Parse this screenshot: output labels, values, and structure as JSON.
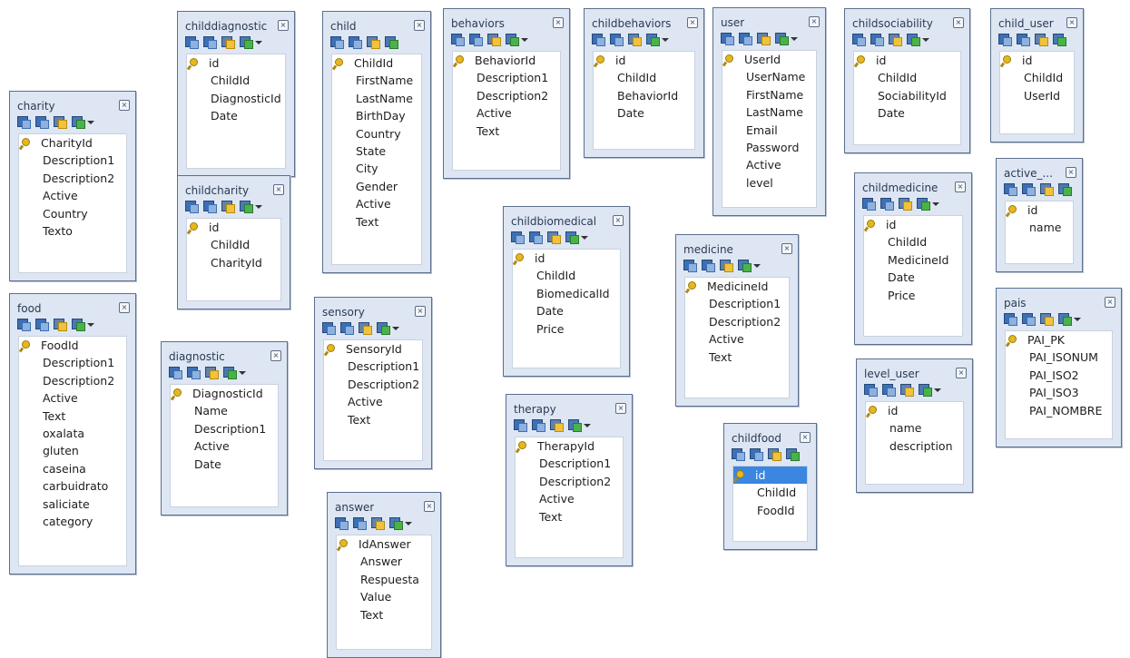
{
  "tables": [
    {
      "name": "charity",
      "fields": [
        "CharityId",
        "Description1",
        "Description2",
        "Active",
        "Country",
        "Texto"
      ],
      "key": "CharityId"
    },
    {
      "name": "food",
      "fields": [
        "FoodId",
        "Description1",
        "Description2",
        "Active",
        "Text",
        "oxalata",
        "gluten",
        "caseina",
        "carbuidrato",
        "saliciate",
        "category"
      ],
      "key": "FoodId"
    },
    {
      "name": "childdiagnostic",
      "fields": [
        "id",
        "ChildId",
        "DiagnosticId",
        "Date"
      ],
      "key": "id"
    },
    {
      "name": "childcharity",
      "fields": [
        "id",
        "ChildId",
        "CharityId"
      ],
      "key": "id"
    },
    {
      "name": "diagnostic",
      "fields": [
        "DiagnosticId",
        "Name",
        "Description1",
        "Active",
        "Date"
      ],
      "key": "DiagnosticId"
    },
    {
      "name": "child",
      "fields": [
        "ChildId",
        "FirstName",
        "LastName",
        "BirthDay",
        "Country",
        "State",
        "City",
        "Gender",
        "Active",
        "Text"
      ],
      "key": "ChildId"
    },
    {
      "name": "sensory",
      "fields": [
        "SensoryId",
        "Description1",
        "Description2",
        "Active",
        "Text"
      ],
      "key": "SensoryId"
    },
    {
      "name": "answer",
      "fields": [
        "IdAnswer",
        "Answer",
        "Respuesta",
        "Value",
        "Text"
      ],
      "key": "IdAnswer"
    },
    {
      "name": "behaviors",
      "fields": [
        "BehaviorId",
        "Description1",
        "Description2",
        "Active",
        "Text"
      ],
      "key": "BehaviorId"
    },
    {
      "name": "childbiomedical",
      "fields": [
        "id",
        "ChildId",
        "BiomedicalId",
        "Date",
        "Price"
      ],
      "key": "id"
    },
    {
      "name": "therapy",
      "fields": [
        "TherapyId",
        "Description1",
        "Description2",
        "Active",
        "Text"
      ],
      "key": "TherapyId"
    },
    {
      "name": "childbehaviors",
      "fields": [
        "id",
        "ChildId",
        "BehaviorId",
        "Date"
      ],
      "key": "id"
    },
    {
      "name": "medicine",
      "fields": [
        "MedicineId",
        "Description1",
        "Description2",
        "Active",
        "Text"
      ],
      "key": "MedicineId"
    },
    {
      "name": "user",
      "fields": [
        "UserId",
        "UserName",
        "FirstName",
        "LastName",
        "Email",
        "Password",
        "Active",
        "level"
      ],
      "key": "UserId"
    },
    {
      "name": "childfood",
      "fields": [
        "id",
        "ChildId",
        "FoodId"
      ],
      "key": "id",
      "selected": "id"
    },
    {
      "name": "childsociability",
      "fields": [
        "id",
        "ChildId",
        "SociabilityId",
        "Date"
      ],
      "key": "id"
    },
    {
      "name": "childmedicine",
      "fields": [
        "id",
        "ChildId",
        "MedicineId",
        "Date",
        "Price"
      ],
      "key": "id"
    },
    {
      "name": "level_user",
      "fields": [
        "id",
        "name",
        "description"
      ],
      "key": "id"
    },
    {
      "name": "child_user",
      "fields": [
        "id",
        "ChildId",
        "UserId"
      ],
      "key": "id"
    },
    {
      "name": "active_...",
      "fields": [
        "id",
        "name"
      ],
      "key": "id"
    },
    {
      "name": "pais",
      "fields": [
        "PAI_PK",
        "PAI_ISONUM",
        "PAI_ISO2",
        "PAI_ISO3",
        "PAI_NOMBRE"
      ],
      "key": "PAI_PK"
    }
  ],
  "icons": {
    "close": "close-icon",
    "key": "primary-key-icon"
  },
  "colors": {
    "panel": "#dde6f2",
    "border": "#5b6f8e",
    "selected": "#3a86e0"
  }
}
